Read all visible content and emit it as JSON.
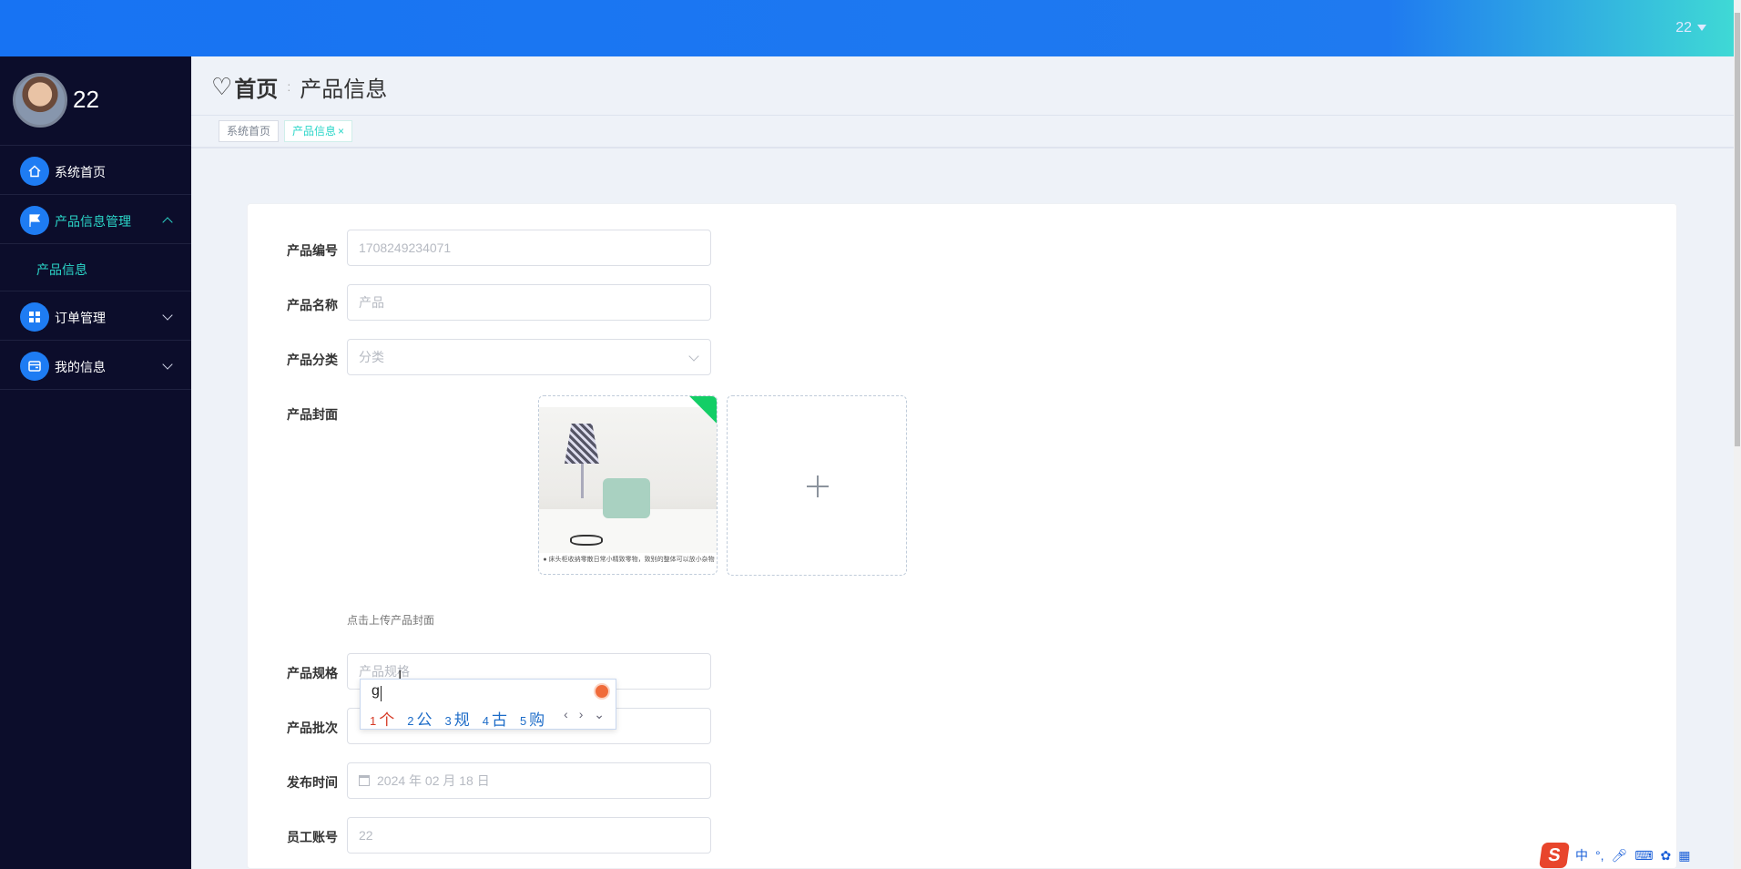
{
  "header": {
    "username": "22"
  },
  "sidebar": {
    "profile_name": "22",
    "items": [
      {
        "label": "系统首页",
        "icon": "home-icon"
      },
      {
        "label": "产品信息管理",
        "icon": "flag-icon",
        "expanded": true,
        "children": [
          {
            "label": "产品信息"
          }
        ]
      },
      {
        "label": "订单管理",
        "icon": "grid-icon"
      },
      {
        "label": "我的信息",
        "icon": "wallet-icon"
      }
    ]
  },
  "breadcrumb": {
    "home": "首页",
    "current": "产品信息"
  },
  "tags": [
    {
      "label": "系统首页"
    },
    {
      "label": "产品信息",
      "close": "×"
    }
  ],
  "form": {
    "code_label": "产品编号",
    "code_value": "1708249234071",
    "name_label": "产品名称",
    "name_placeholder": "产品",
    "category_label": "产品分类",
    "category_placeholder": "分类",
    "cover_label": "产品封面",
    "cover_caption": "● 床头柜收纳零散日常小精致零物，致别的整体可以放小杂物",
    "cover_hint": "点击上传产品封面",
    "spec_label": "产品规格",
    "spec_placeholder": "产品规格",
    "batch_label": "产品批次",
    "date_label": "发布时间",
    "date_value": "2024 年 02 月 18 日",
    "account_label": "员工账号",
    "account_value": "22"
  },
  "ime": {
    "typed": "g",
    "candidates": [
      {
        "n": "1",
        "w": "个"
      },
      {
        "n": "2",
        "w": "公"
      },
      {
        "n": "3",
        "w": "规"
      },
      {
        "n": "4",
        "w": "古"
      },
      {
        "n": "5",
        "w": "购"
      }
    ],
    "nav": "‹ › ⌄"
  },
  "tray": {
    "logo": "S",
    "lang": "中",
    "punct": "°,"
  }
}
